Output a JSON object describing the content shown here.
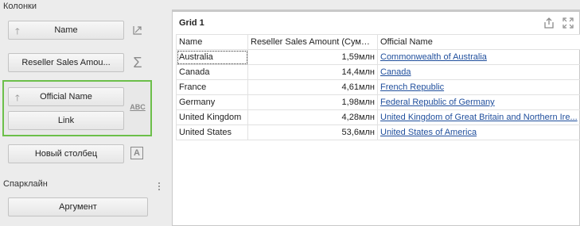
{
  "panel": {
    "columns_label": "Колонки",
    "sparkline_label": "Спарклайн"
  },
  "columns": [
    {
      "label": "Name",
      "has_arrow": true,
      "side_icon": "expand-arrows-icon"
    },
    {
      "label": "Reseller Sales Amou...",
      "has_arrow": false,
      "side_icon": "sigma-icon"
    },
    {
      "label": "Official Name",
      "has_arrow": true,
      "side_icon": "abc-icon",
      "side_text": "ABC"
    },
    {
      "label": "Link",
      "has_arrow": false
    },
    {
      "label": "Новый столбец",
      "has_arrow": false,
      "side_icon": "letter-a-icon",
      "side_text": "A"
    }
  ],
  "sparkline": {
    "argument_label": "Аргумент"
  },
  "grid": {
    "title": "Grid 1",
    "headers": [
      "Name",
      "Reseller Sales Amount (Сумма)",
      "Official Name"
    ],
    "rows": [
      {
        "name": "Australia",
        "amount": "1,59млн",
        "official": "Commonwealth of Australia"
      },
      {
        "name": "Canada",
        "amount": "14,4млн",
        "official": "Canada"
      },
      {
        "name": "France",
        "amount": "4,61млн",
        "official": "French Republic"
      },
      {
        "name": "Germany",
        "amount": "1,98млн",
        "official": "Federal Republic of Germany"
      },
      {
        "name": "United Kingdom",
        "amount": "4,28млн",
        "official": "United Kingdom of Great Britain and Northern Ire..."
      },
      {
        "name": "United States",
        "amount": "53,6млн",
        "official": "United States of America"
      }
    ]
  },
  "colors": {
    "highlight_border": "#6cbf4a",
    "link": "#1f4e9c"
  }
}
